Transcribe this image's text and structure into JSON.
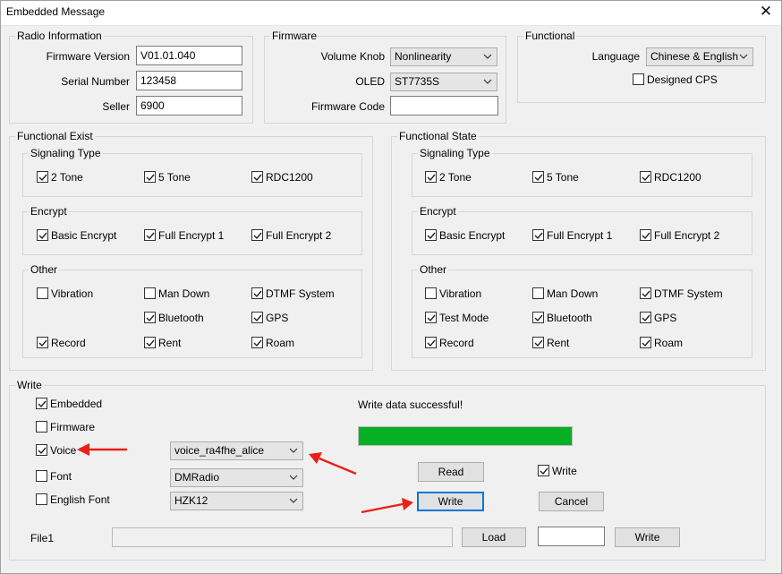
{
  "window": {
    "title": "Embedded Message",
    "close_glyph": "✕"
  },
  "radio_info": {
    "legend": "Radio Information",
    "firmware_version_label": "Firmware Version",
    "firmware_version_value": "V01.01.040",
    "serial_number_label": "Serial Number",
    "serial_number_value": "123458",
    "seller_label": "Seller",
    "seller_value": "6900"
  },
  "firmware": {
    "legend": "Firmware",
    "volume_knob_label": "Volume Knob",
    "volume_knob_value": "Nonlinearity",
    "oled_label": "OLED",
    "oled_value": "ST7735S",
    "firmware_code_label": "Firmware Code",
    "firmware_code_value": ""
  },
  "functional": {
    "legend": "Functional",
    "language_label": "Language",
    "language_value": "Chinese & English",
    "designed_cps_label": "Designed CPS",
    "designed_cps_checked": false
  },
  "functional_exist": {
    "legend": "Functional Exist",
    "signaling_legend": "Signaling Type",
    "tone2": {
      "label": "2 Tone",
      "checked": true
    },
    "tone5": {
      "label": "5 Tone",
      "checked": true
    },
    "rdc1200": {
      "label": "RDC1200",
      "checked": true
    },
    "encrypt_legend": "Encrypt",
    "basic_encrypt": {
      "label": "Basic Encrypt",
      "checked": true
    },
    "full_encrypt1": {
      "label": "Full Encrypt 1",
      "checked": true
    },
    "full_encrypt2": {
      "label": "Full Encrypt 2",
      "checked": true
    },
    "other_legend": "Other",
    "vibration": {
      "label": "Vibration",
      "checked": false
    },
    "man_down": {
      "label": "Man Down",
      "checked": false
    },
    "dtmf_system": {
      "label": "DTMF System",
      "checked": true
    },
    "bluetooth": {
      "label": "Bluetooth",
      "checked": true
    },
    "gps": {
      "label": "GPS",
      "checked": true
    },
    "record": {
      "label": "Record",
      "checked": true
    },
    "rent": {
      "label": "Rent",
      "checked": true
    },
    "roam": {
      "label": "Roam",
      "checked": true
    }
  },
  "functional_state": {
    "legend": "Functional State",
    "signaling_legend": "Signaling Type",
    "tone2": {
      "label": "2 Tone",
      "checked": true
    },
    "tone5": {
      "label": "5 Tone",
      "checked": true
    },
    "rdc1200": {
      "label": "RDC1200",
      "checked": true
    },
    "encrypt_legend": "Encrypt",
    "basic_encrypt": {
      "label": "Basic Encrypt",
      "checked": true
    },
    "full_encrypt1": {
      "label": "Full Encrypt 1",
      "checked": true
    },
    "full_encrypt2": {
      "label": "Full Encrypt 2",
      "checked": true
    },
    "other_legend": "Other",
    "vibration": {
      "label": "Vibration",
      "checked": false
    },
    "man_down": {
      "label": "Man Down",
      "checked": false
    },
    "dtmf_system": {
      "label": "DTMF System",
      "checked": true
    },
    "test_mode": {
      "label": "Test Mode",
      "checked": true
    },
    "bluetooth": {
      "label": "Bluetooth",
      "checked": true
    },
    "gps": {
      "label": "GPS",
      "checked": true
    },
    "record": {
      "label": "Record",
      "checked": true
    },
    "rent": {
      "label": "Rent",
      "checked": true
    },
    "roam": {
      "label": "Roam",
      "checked": true
    }
  },
  "write": {
    "legend": "Write",
    "embedded": {
      "label": "Embedded",
      "checked": true
    },
    "firmware": {
      "label": "Firmware",
      "checked": false
    },
    "voice": {
      "label": "Voice",
      "checked": true
    },
    "font": {
      "label": "Font",
      "checked": false
    },
    "english_font": {
      "label": "English Font",
      "checked": false
    },
    "voice_value": "voice_ra4fhe_alice",
    "font_value": "DMRadio",
    "english_font_value": "HZK12",
    "status": "Write data successful!",
    "progress_fraction": 1.0,
    "read_button": "Read",
    "write_checkbox": {
      "label": "Write",
      "checked": true
    },
    "write_button": "Write",
    "cancel_button": "Cancel",
    "file1_label": "File1",
    "file1_path": "",
    "load_button": "Load",
    "file1_value": "",
    "file1_write_button": "Write"
  },
  "colors": {
    "progress": "#06b025",
    "annotation_arrow": "#e8201a",
    "focus_border": "#0078d7"
  }
}
